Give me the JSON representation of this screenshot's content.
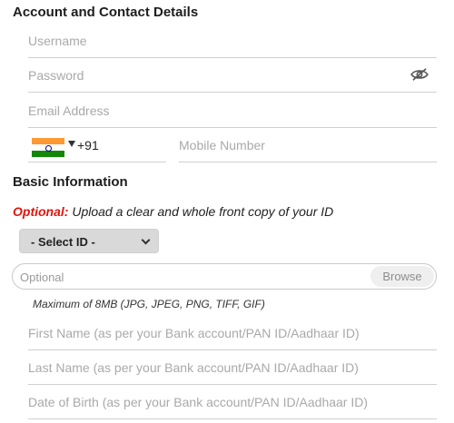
{
  "account_section": {
    "title": "Account and Contact Details",
    "username_placeholder": "Username",
    "password_placeholder": "Password",
    "email_placeholder": "Email Address",
    "country_code": "+91",
    "mobile_placeholder": "Mobile Number",
    "icons": {
      "password_toggle": "eye-slash-icon",
      "flag": "india-flag-icon",
      "dropdown": "caret-down-icon"
    }
  },
  "basic_section": {
    "title": "Basic Information",
    "optional_label": "Optional:",
    "upload_instruction": "Upload a clear and whole front copy of your ID",
    "select_id_label": "- Select ID -",
    "upload_placeholder": "Optional",
    "browse_label": "Browse",
    "file_hint": "Maximum of 8MB (JPG, JPEG, PNG, TIFF, GIF)",
    "first_name_placeholder": "First Name (as per your Bank account/PAN ID/Aadhaar ID)",
    "last_name_placeholder": "Last Name (as per your Bank account/PAN ID/Aadhaar ID)",
    "dob_placeholder": "Date of Birth (as per your Bank account/PAN ID/Aadhaar ID)"
  },
  "colors": {
    "optional_red": "#e0140c",
    "divider": "#cfcfcf",
    "select_bg": "#d9d9d9"
  }
}
